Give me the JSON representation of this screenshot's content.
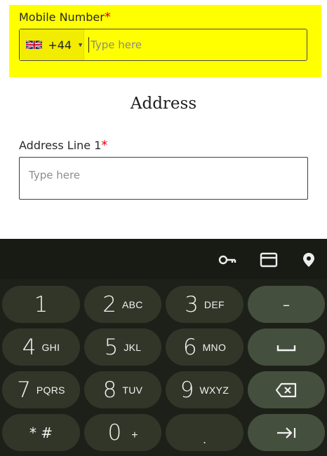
{
  "form": {
    "mobile_label": "Mobile Number",
    "required_mark": "*",
    "country_code": "+44",
    "mobile_placeholder": "Type here",
    "address_title": "Address",
    "address_line1_label": "Address Line 1",
    "address_line1_placeholder": "Type here"
  },
  "colors": {
    "highlight": "#ffff00",
    "required": "#e00000",
    "keyboard_bg": "#1d2019",
    "key_bg": "#323629",
    "action_key_bg": "#454f3e"
  },
  "keyboard": {
    "toolbar_icons": [
      "key-icon",
      "credit-card-icon",
      "location-pin-icon"
    ],
    "rows": [
      [
        {
          "main": "1",
          "sub": ""
        },
        {
          "main": "2",
          "sub": "ABC"
        },
        {
          "main": "3",
          "sub": "DEF"
        },
        {
          "main": "–",
          "sub": ""
        }
      ],
      [
        {
          "main": "4",
          "sub": "GHI"
        },
        {
          "main": "5",
          "sub": "JKL"
        },
        {
          "main": "6",
          "sub": "MNO"
        },
        {
          "main": "space-icon",
          "sub": ""
        }
      ],
      [
        {
          "main": "7",
          "sub": "PQRS"
        },
        {
          "main": "8",
          "sub": "TUV"
        },
        {
          "main": "9",
          "sub": "WXYZ"
        },
        {
          "main": "backspace-icon",
          "sub": ""
        }
      ],
      [
        {
          "main": "* #",
          "sub": ""
        },
        {
          "main": "0",
          "sub": "+"
        },
        {
          "main": ".",
          "sub": ""
        },
        {
          "main": "tab-icon",
          "sub": ""
        }
      ]
    ]
  }
}
